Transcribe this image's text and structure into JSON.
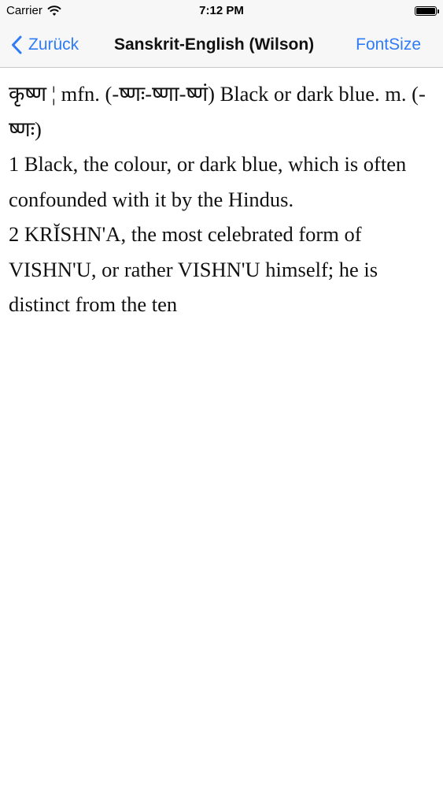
{
  "status_bar": {
    "carrier": "Carrier",
    "time": "7:12 PM",
    "battery_level": 1.0
  },
  "nav": {
    "back_label": "Zurück",
    "title": "Sanskrit-English (Wilson)",
    "fontsize_label": "FontSize"
  },
  "entry": {
    "headword_line": "कृष्ण ¦ mfn. (-ष्णः-ष्णा-ष्णं) Black or dark blue. m. (-ष्णः)",
    "sense_1": "1 Black, the colour, or dark blue, which is often confounded with it by the Hindus.",
    "sense_2": "2 KRĬSHN'A, the most celebrated form of VISHN'U, or rather VISHN'U himself; he is distinct from the ten"
  },
  "colors": {
    "accent": "#2f7cf6",
    "bar_background": "#f7f7f7"
  }
}
